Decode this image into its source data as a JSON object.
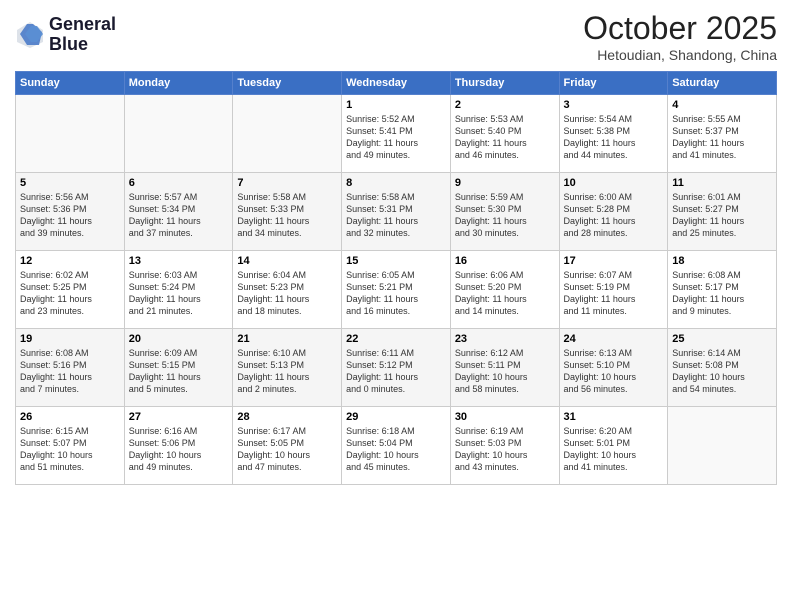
{
  "header": {
    "logo_line1": "General",
    "logo_line2": "Blue",
    "month": "October 2025",
    "location": "Hetoudian, Shandong, China"
  },
  "days_of_week": [
    "Sunday",
    "Monday",
    "Tuesday",
    "Wednesday",
    "Thursday",
    "Friday",
    "Saturday"
  ],
  "weeks": [
    [
      {
        "day": "",
        "info": ""
      },
      {
        "day": "",
        "info": ""
      },
      {
        "day": "",
        "info": ""
      },
      {
        "day": "1",
        "info": "Sunrise: 5:52 AM\nSunset: 5:41 PM\nDaylight: 11 hours\nand 49 minutes."
      },
      {
        "day": "2",
        "info": "Sunrise: 5:53 AM\nSunset: 5:40 PM\nDaylight: 11 hours\nand 46 minutes."
      },
      {
        "day": "3",
        "info": "Sunrise: 5:54 AM\nSunset: 5:38 PM\nDaylight: 11 hours\nand 44 minutes."
      },
      {
        "day": "4",
        "info": "Sunrise: 5:55 AM\nSunset: 5:37 PM\nDaylight: 11 hours\nand 41 minutes."
      }
    ],
    [
      {
        "day": "5",
        "info": "Sunrise: 5:56 AM\nSunset: 5:36 PM\nDaylight: 11 hours\nand 39 minutes."
      },
      {
        "day": "6",
        "info": "Sunrise: 5:57 AM\nSunset: 5:34 PM\nDaylight: 11 hours\nand 37 minutes."
      },
      {
        "day": "7",
        "info": "Sunrise: 5:58 AM\nSunset: 5:33 PM\nDaylight: 11 hours\nand 34 minutes."
      },
      {
        "day": "8",
        "info": "Sunrise: 5:58 AM\nSunset: 5:31 PM\nDaylight: 11 hours\nand 32 minutes."
      },
      {
        "day": "9",
        "info": "Sunrise: 5:59 AM\nSunset: 5:30 PM\nDaylight: 11 hours\nand 30 minutes."
      },
      {
        "day": "10",
        "info": "Sunrise: 6:00 AM\nSunset: 5:28 PM\nDaylight: 11 hours\nand 28 minutes."
      },
      {
        "day": "11",
        "info": "Sunrise: 6:01 AM\nSunset: 5:27 PM\nDaylight: 11 hours\nand 25 minutes."
      }
    ],
    [
      {
        "day": "12",
        "info": "Sunrise: 6:02 AM\nSunset: 5:25 PM\nDaylight: 11 hours\nand 23 minutes."
      },
      {
        "day": "13",
        "info": "Sunrise: 6:03 AM\nSunset: 5:24 PM\nDaylight: 11 hours\nand 21 minutes."
      },
      {
        "day": "14",
        "info": "Sunrise: 6:04 AM\nSunset: 5:23 PM\nDaylight: 11 hours\nand 18 minutes."
      },
      {
        "day": "15",
        "info": "Sunrise: 6:05 AM\nSunset: 5:21 PM\nDaylight: 11 hours\nand 16 minutes."
      },
      {
        "day": "16",
        "info": "Sunrise: 6:06 AM\nSunset: 5:20 PM\nDaylight: 11 hours\nand 14 minutes."
      },
      {
        "day": "17",
        "info": "Sunrise: 6:07 AM\nSunset: 5:19 PM\nDaylight: 11 hours\nand 11 minutes."
      },
      {
        "day": "18",
        "info": "Sunrise: 6:08 AM\nSunset: 5:17 PM\nDaylight: 11 hours\nand 9 minutes."
      }
    ],
    [
      {
        "day": "19",
        "info": "Sunrise: 6:08 AM\nSunset: 5:16 PM\nDaylight: 11 hours\nand 7 minutes."
      },
      {
        "day": "20",
        "info": "Sunrise: 6:09 AM\nSunset: 5:15 PM\nDaylight: 11 hours\nand 5 minutes."
      },
      {
        "day": "21",
        "info": "Sunrise: 6:10 AM\nSunset: 5:13 PM\nDaylight: 11 hours\nand 2 minutes."
      },
      {
        "day": "22",
        "info": "Sunrise: 6:11 AM\nSunset: 5:12 PM\nDaylight: 11 hours\nand 0 minutes."
      },
      {
        "day": "23",
        "info": "Sunrise: 6:12 AM\nSunset: 5:11 PM\nDaylight: 10 hours\nand 58 minutes."
      },
      {
        "day": "24",
        "info": "Sunrise: 6:13 AM\nSunset: 5:10 PM\nDaylight: 10 hours\nand 56 minutes."
      },
      {
        "day": "25",
        "info": "Sunrise: 6:14 AM\nSunset: 5:08 PM\nDaylight: 10 hours\nand 54 minutes."
      }
    ],
    [
      {
        "day": "26",
        "info": "Sunrise: 6:15 AM\nSunset: 5:07 PM\nDaylight: 10 hours\nand 51 minutes."
      },
      {
        "day": "27",
        "info": "Sunrise: 6:16 AM\nSunset: 5:06 PM\nDaylight: 10 hours\nand 49 minutes."
      },
      {
        "day": "28",
        "info": "Sunrise: 6:17 AM\nSunset: 5:05 PM\nDaylight: 10 hours\nand 47 minutes."
      },
      {
        "day": "29",
        "info": "Sunrise: 6:18 AM\nSunset: 5:04 PM\nDaylight: 10 hours\nand 45 minutes."
      },
      {
        "day": "30",
        "info": "Sunrise: 6:19 AM\nSunset: 5:03 PM\nDaylight: 10 hours\nand 43 minutes."
      },
      {
        "day": "31",
        "info": "Sunrise: 6:20 AM\nSunset: 5:01 PM\nDaylight: 10 hours\nand 41 minutes."
      },
      {
        "day": "",
        "info": ""
      }
    ]
  ]
}
